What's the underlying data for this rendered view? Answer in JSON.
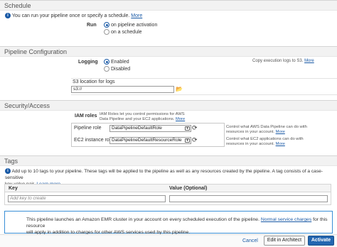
{
  "schedule": {
    "header": "Schedule",
    "info_text": "You can run your pipeline once or specify a schedule.",
    "more": "More",
    "run_label": "Run",
    "options": [
      "on pipeline activation",
      "on a schedule"
    ],
    "selected_index": 0
  },
  "pipeline_config": {
    "header": "Pipeline Configuration",
    "logging_label": "Logging",
    "logging_options": [
      "Enabled",
      "Disabled"
    ],
    "logging_selected_index": 0,
    "copy_note": "Copy execution logs to S3.",
    "more": "More",
    "s3_label": "S3 location for logs",
    "s3_value": "s3://"
  },
  "security": {
    "header": "Security/Access",
    "iam_label": "IAM roles",
    "iam_desc_line1": "IAM Roles let you control permissions for AWS",
    "iam_desc_line2": "Data Pipeline and your EC2 applications.",
    "more": "More",
    "pipeline_role_label": "Pipeline role",
    "pipeline_role_value": "DataPipelineDefaultRole",
    "pipeline_role_desc_line1": "Control what AWS Data Pipeline can do with",
    "pipeline_role_desc_line2": "resources in your account.",
    "ec2_role_label": "EC2 instance role",
    "ec2_role_value": "DataPipelineDefaultResourceRole",
    "ec2_role_desc_line1": "Control what EC2 applications can do with",
    "ec2_role_desc_line2": "resources in your account."
  },
  "tags": {
    "header": "Tags",
    "info_line1": "Add up to 10 tags to your pipeline. These tags will be applied to the pipeline as well as any resources created by the pipeline. A tag consists of a case-sensitive",
    "info_line2": "key-value pair.",
    "learn_more": "Learn more",
    "col_key": "Key",
    "col_value": "Value (Optional)",
    "key_placeholder": "Add key to create"
  },
  "notice": {
    "line1_pre": "This pipeline launches an Amazon EMR cluster in your account on every scheduled execution of the pipeline.",
    "link": "Normal service charges",
    "line1_post": "for this resource",
    "line2": "will apply in addition to charges for other AWS services used by this pipeline."
  },
  "footer": {
    "cancel": "Cancel",
    "edit_architect": "Edit in Architect",
    "activate": "Activate"
  },
  "colors": {
    "link": "#1a5aa6",
    "primary_button": "#2366b0",
    "notice_border": "#3a8fd6",
    "section_header_bg": "#f2f2f2"
  }
}
